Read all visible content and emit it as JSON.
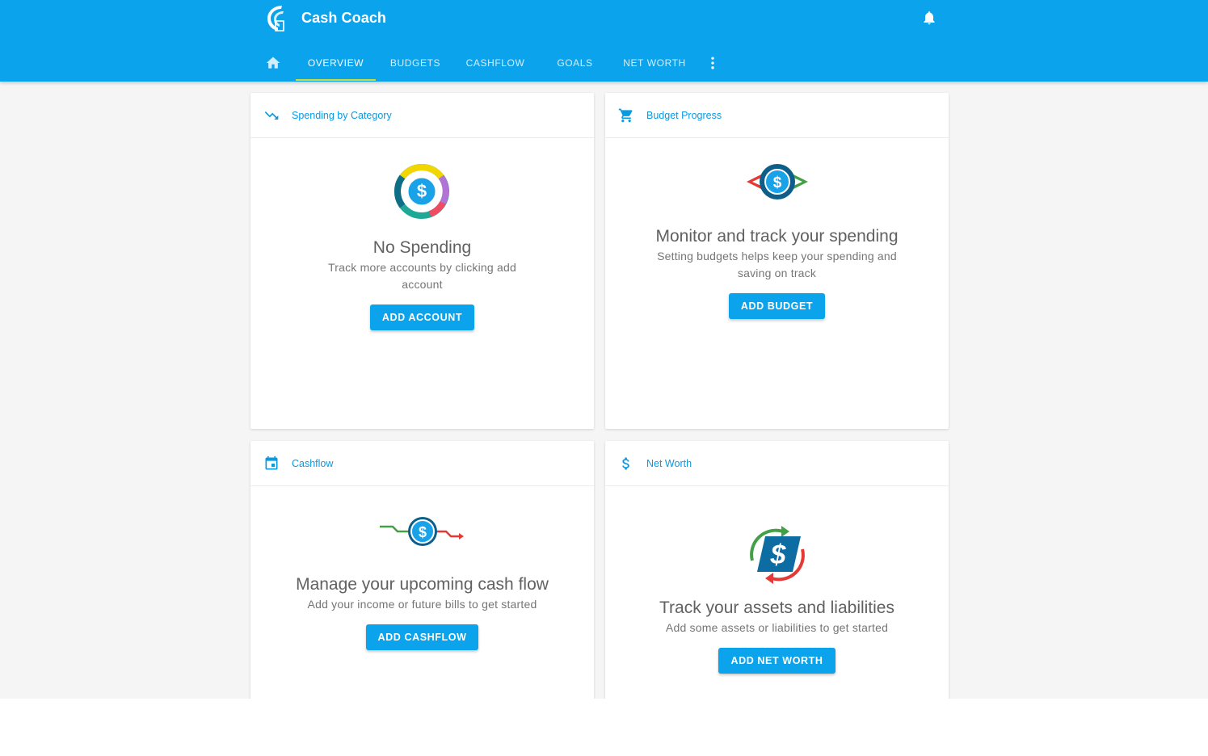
{
  "app": {
    "title": "Cash Coach"
  },
  "header": {
    "logo_icon": "cash-coach-logo",
    "notification_icon": "bell-icon"
  },
  "nav": {
    "home_icon": "home-icon",
    "tabs": [
      {
        "label": "OVERVIEW",
        "active": true
      },
      {
        "label": "BUDGETS",
        "active": false
      },
      {
        "label": "CASHFLOW",
        "active": false
      },
      {
        "label": "GOALS",
        "active": false
      },
      {
        "label": "NET WORTH",
        "active": false
      }
    ],
    "more_icon": "more-vert-icon"
  },
  "cards": {
    "spending": {
      "title": "Spending by Category",
      "icon": "trending-down-icon",
      "illustration": "donut-dollar-icon",
      "headline": "No Spending",
      "line1": "Track more accounts by clicking add",
      "line2": "account",
      "button": "ADD ACCOUNT"
    },
    "budget": {
      "title": "Budget Progress",
      "icon": "cart-icon",
      "illustration": "budget-dollar-icon",
      "headline": "Monitor and track your spending",
      "line1": "Setting budgets helps keep your spending and",
      "line2": "saving on track",
      "button": "ADD BUDGET"
    },
    "cashflow": {
      "title": "Cashflow",
      "icon": "calendar-icon",
      "illustration": "cashflow-dollar-icon",
      "headline": "Manage your upcoming cash flow",
      "line1": "Add your income or future bills to get started",
      "button": "ADD CASHFLOW"
    },
    "networth": {
      "title": "Net Worth",
      "icon": "dollar-icon",
      "illustration": "networth-cycle-icon",
      "headline": "Track your assets and liabilities",
      "line1": "Add some assets or liabilities to get started",
      "button": "ADD NET WORTH"
    }
  },
  "colors": {
    "primary": "#0aa3ec",
    "accent": "#cddc39",
    "link": "#0a9ae0"
  }
}
